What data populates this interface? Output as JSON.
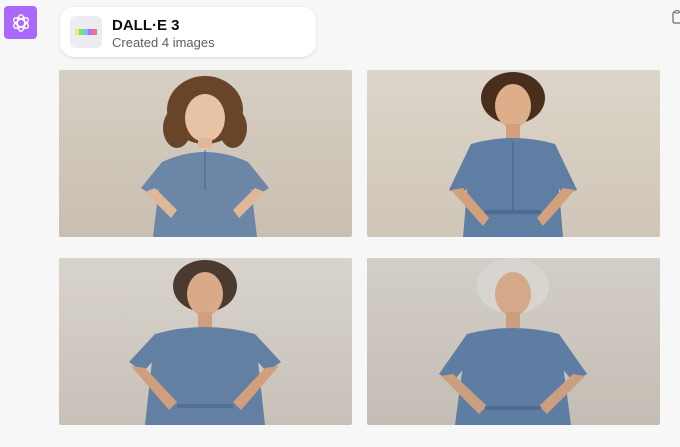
{
  "assistant": {
    "icon": "openai-logo-icon",
    "accent": "#ab68ff"
  },
  "tool_card": {
    "title": "DALL·E 3",
    "subtitle": "Created 4 images",
    "icon": "dalle-palette-icon",
    "palette": [
      "#f5e663",
      "#7ce36b",
      "#64c9f2",
      "#c66bf2",
      "#f2766b"
    ]
  },
  "toolbar": {
    "copy_icon": "copy-icon"
  },
  "images": [
    {
      "subject": "child",
      "hair": "#5a3a22",
      "dress": "#6b86a6"
    },
    {
      "subject": "young-woman",
      "hair": "#4a2e1c",
      "dress": "#5f7ea3"
    },
    {
      "subject": "middle-aged-woman",
      "hair": "#4a3a30",
      "dress": "#6380a3"
    },
    {
      "subject": "older-woman",
      "hair": "#d8d4cf",
      "dress": "#5e7da2"
    }
  ]
}
